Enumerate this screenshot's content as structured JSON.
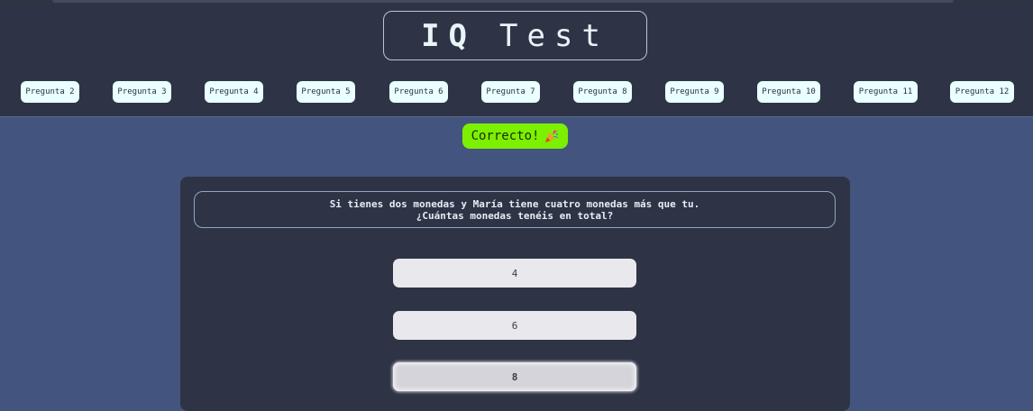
{
  "header": {
    "title_bold": "IQ",
    "title_rest": "Test"
  },
  "nav": {
    "items": [
      {
        "label": "Pregunta 2"
      },
      {
        "label": "Pregunta 3"
      },
      {
        "label": "Pregunta 4"
      },
      {
        "label": "Pregunta 5"
      },
      {
        "label": "Pregunta 6"
      },
      {
        "label": "Pregunta 7"
      },
      {
        "label": "Pregunta 8"
      },
      {
        "label": "Pregunta 9"
      },
      {
        "label": "Pregunta 10"
      },
      {
        "label": "Pregunta 11"
      },
      {
        "label": "Pregunta 12"
      }
    ]
  },
  "feedback": {
    "text": "Correcto!",
    "icon": "party-popper-icon",
    "color": "#7cf000"
  },
  "question": {
    "line1": "Si tienes dos monedas y María tiene cuatro monedas más que tu.",
    "line2": "¿Cuántas monedas tenéis en total?"
  },
  "answers": [
    {
      "label": "4",
      "selected": false
    },
    {
      "label": "6",
      "selected": false
    },
    {
      "label": "8",
      "selected": true
    }
  ],
  "colors": {
    "background": "#43557f",
    "panel": "#2e3445",
    "nav_button": "#eaffff",
    "answer_button": "#e9e8ed"
  }
}
